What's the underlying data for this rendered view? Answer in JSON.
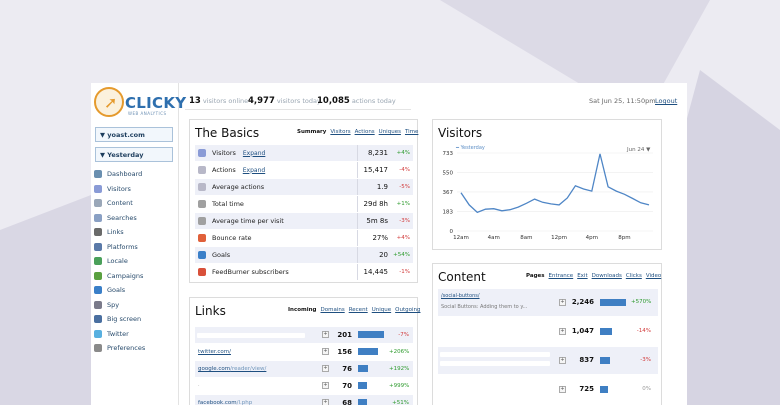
{
  "logo": {
    "brand": "CLICKY",
    "tagline": "WEB ANALYTICS",
    "cursor": "cursor-icon"
  },
  "site_selector": {
    "value": "▼ yoast.com"
  },
  "date_selector": {
    "value": "▼ Yesterday"
  },
  "nav": [
    {
      "label": "Dashboard",
      "icon": "dashboard-icon",
      "color": "#6a8fb0"
    },
    {
      "label": "Visitors",
      "icon": "visitors-icon",
      "color": "#8a9bd6"
    },
    {
      "label": "Content",
      "icon": "content-icon",
      "color": "#9aa7b8"
    },
    {
      "label": "Searches",
      "icon": "search-icon",
      "color": "#8aa0c4"
    },
    {
      "label": "Links",
      "icon": "links-icon",
      "color": "#6a6a6a"
    },
    {
      "label": "Platforms",
      "icon": "platforms-icon",
      "color": "#5a79a8"
    },
    {
      "label": "Locale",
      "icon": "locale-icon",
      "color": "#4aa05a"
    },
    {
      "label": "Campaigns",
      "icon": "campaigns-icon",
      "color": "#5aa040"
    },
    {
      "label": "Goals",
      "icon": "goals-icon",
      "color": "#3a7fc8"
    },
    {
      "label": "Spy",
      "icon": "spy-icon",
      "color": "#7a7a8a"
    },
    {
      "label": "Big screen",
      "icon": "bigscreen-icon",
      "color": "#4a6fa0"
    },
    {
      "label": "Twitter",
      "icon": "twitter-icon",
      "color": "#58b0e0"
    },
    {
      "label": "Preferences",
      "icon": "gear-icon",
      "color": "#8a8a8a"
    }
  ],
  "header": {
    "visitors_online": {
      "value": "13",
      "label": "visitors online"
    },
    "visitors_today": {
      "value": "4,977",
      "label": "visitors today"
    },
    "actions_today": {
      "value": "10,085",
      "label": "actions today"
    },
    "datetime": "Sat Jun 25, 11:50pm",
    "logout": "Logout"
  },
  "basics": {
    "title": "The Basics",
    "tabs": [
      "Summary",
      "Visitors",
      "Actions",
      "Uniques",
      "Time"
    ],
    "expand_label": "Expand",
    "rows": [
      {
        "label": "Visitors",
        "value": "8,231",
        "change": "+4%",
        "trend": "up",
        "expand": true,
        "icon": "visitors-icon",
        "color": "#8a9bd6"
      },
      {
        "label": "Actions",
        "value": "15,417",
        "change": "-4%",
        "trend": "down",
        "expand": true,
        "icon": "actions-icon",
        "color": "#b8b8c8"
      },
      {
        "label": "Average actions",
        "value": "1.9",
        "change": "-5%",
        "trend": "down",
        "expand": false,
        "icon": "actions-icon",
        "color": "#b8b8c8"
      },
      {
        "label": "Total time",
        "value": "29d 8h",
        "change": "+1%",
        "trend": "up",
        "expand": false,
        "icon": "clock-icon",
        "color": "#a0a0a0"
      },
      {
        "label": "Average time per visit",
        "value": "5m 8s",
        "change": "-3%",
        "trend": "down",
        "expand": false,
        "icon": "clock-icon",
        "color": "#a0a0a0"
      },
      {
        "label": "Bounce rate",
        "value": "27%",
        "change": "+4%",
        "trend": "down",
        "expand": false,
        "icon": "bounce-icon",
        "color": "#e0603a"
      },
      {
        "label": "Goals",
        "value": "20",
        "change": "+54%",
        "trend": "up",
        "expand": false,
        "icon": "goals-icon",
        "color": "#3a7fc8"
      },
      {
        "label": "FeedBurner subscribers",
        "value": "14,445",
        "change": "-1%",
        "trend": "down",
        "expand": false,
        "icon": "feedburner-icon",
        "color": "#d8503a"
      }
    ]
  },
  "visitors_chart": {
    "title": "Visitors",
    "date_label": "Jun 24 ▼",
    "chart_data": {
      "type": "line",
      "x": [
        "12am",
        "1am",
        "2am",
        "3am",
        "4am",
        "5am",
        "6am",
        "7am",
        "8am",
        "9am",
        "10am",
        "11am",
        "12pm",
        "1pm",
        "2pm",
        "3pm",
        "4pm",
        "5pm",
        "6pm",
        "7pm",
        "8pm",
        "9pm",
        "10pm",
        "11pm"
      ],
      "x_tick_labels": [
        "12am",
        "4am",
        "8am",
        "12pm",
        "4pm",
        "8pm"
      ],
      "y_ticks": [
        "0",
        "183",
        "367",
        "550",
        "733"
      ],
      "ylim": [
        0,
        733
      ],
      "series": [
        {
          "name": "Yesterday",
          "color": "#4f86c6",
          "values": [
            360,
            245,
            175,
            205,
            210,
            190,
            200,
            225,
            260,
            300,
            270,
            255,
            245,
            310,
            425,
            395,
            375,
            725,
            415,
            375,
            345,
            305,
            265,
            245
          ]
        }
      ]
    }
  },
  "links": {
    "title": "Links",
    "tabs": [
      "Incoming",
      "Domains",
      "Recent",
      "Unique",
      "Outgoing"
    ],
    "rows": [
      {
        "text": "",
        "dim": "",
        "count": "201",
        "bar": 1.0,
        "change": "-7%",
        "trend": "down"
      },
      {
        "text": "twitter.com/",
        "dim": "",
        "count": "156",
        "bar": 0.78,
        "change": "+206%",
        "trend": "up"
      },
      {
        "text": "google.com",
        "dim": "/reader/view/",
        "count": "76",
        "bar": 0.38,
        "change": "+192%",
        "trend": "up"
      },
      {
        "text": "",
        "dim": "",
        "count": "70",
        "bar": 0.35,
        "change": "+999%",
        "trend": "up"
      },
      {
        "text": "facebook.com",
        "dim": "/l.php",
        "count": "68",
        "bar": 0.34,
        "change": "+51%",
        "trend": "up"
      }
    ]
  },
  "content": {
    "title": "Content",
    "tabs": [
      "Pages",
      "Entrance",
      "Exit",
      "Downloads",
      "Clicks",
      "Video"
    ],
    "rows": [
      {
        "path": "/social-buttons/",
        "desc": "Social Buttons: Adding them to y...",
        "count": "2,246",
        "bar": 1.0,
        "change": "+570%",
        "trend": "up"
      },
      {
        "path": "",
        "desc": "",
        "count": "1,047",
        "bar": 0.47,
        "change": "-14%",
        "trend": "down"
      },
      {
        "path": "",
        "desc": "",
        "count": "837",
        "bar": 0.37,
        "change": "-3%",
        "trend": "down"
      },
      {
        "path": "",
        "desc": "",
        "count": "725",
        "bar": 0.32,
        "change": "0%",
        "trend": "neutral"
      }
    ]
  }
}
